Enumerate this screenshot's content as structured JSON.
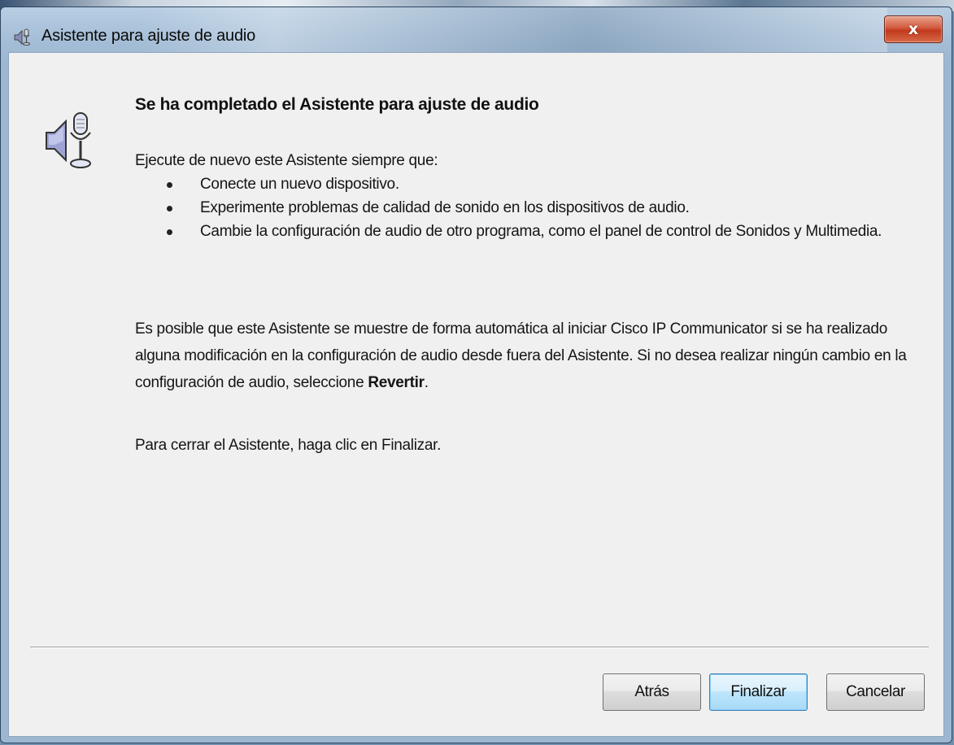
{
  "window": {
    "title": "Asistente para ajuste de audio",
    "close_label": "x",
    "icons": {
      "title": "audio-wizard-icon",
      "main": "speaker-microphone-icon",
      "close": "close-icon"
    }
  },
  "content": {
    "heading": "Se ha completado el Asistente para ajuste de audio",
    "intro": "Ejecute de nuevo este Asistente siempre que:",
    "bullets": [
      "Conecte un nuevo dispositivo.",
      "Experimente problemas de calidad de sonido en los dispositivos de audio.",
      "Cambie la configuración de audio de otro programa, como el panel de control de Sonidos y Multimedia."
    ],
    "para2_prefix": "Es posible que este Asistente se muestre de forma automática al iniciar Cisco IP Communicator si se ha realizado alguna modificación en la configuración de audio desde fuera del Asistente. Si no desea realizar ningún cambio en la configuración de audio, seleccione ",
    "para2_bold": "Revertir",
    "para2_suffix": ".",
    "para3": "Para cerrar el Asistente, haga clic en Finalizar."
  },
  "buttons": {
    "back": "Atrás",
    "finish": "Finalizar",
    "cancel": "Cancelar"
  },
  "colors": {
    "title_bar": "#a5bed7",
    "close_button": "#c9452a",
    "dialog_background": "#f0f0f0",
    "default_button": "#bee6fd"
  }
}
